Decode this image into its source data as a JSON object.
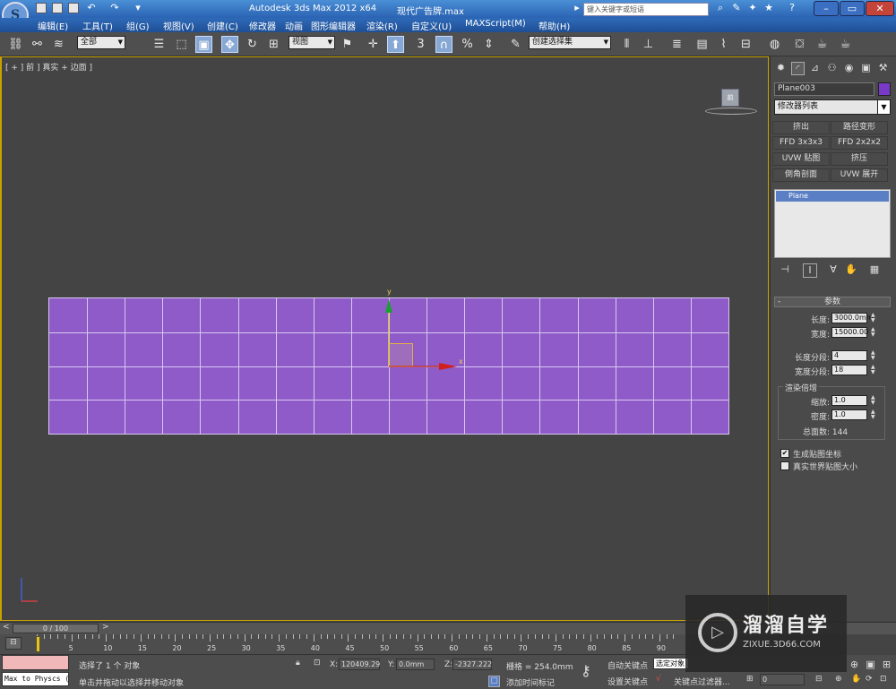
{
  "app": {
    "title": "Autodesk 3ds Max  2012 x64",
    "file": "现代广告牌.max",
    "search_placeholder": "键入关键字或短语"
  },
  "menu": [
    "编辑(E)",
    "工具(T)",
    "组(G)",
    "视图(V)",
    "创建(C)",
    "修改器",
    "动画",
    "图形编辑器",
    "渲染(R)",
    "自定义(U)",
    "MAXScript(M)",
    "帮助(H)"
  ],
  "toolbar": {
    "selection_filter": "全部",
    "ref_coord": "视图",
    "named_selection": "创建选择集",
    "snap_angle_label": "3",
    "percent_snap_label": "%"
  },
  "viewport": {
    "label": "[ + ] 前 ] 真实 + 边面 ]",
    "cube_face": "前",
    "gizmo_y": "y",
    "gizmo_x": "x",
    "plane_color": "#8e5bc9",
    "grid_columns": 18,
    "grid_rows": 4
  },
  "command_panel": {
    "object_name": "Plane003",
    "object_color": "#7a3ac8",
    "modifier_list": "修改器列表",
    "modifier_buttons": [
      "挤出",
      "路径变形",
      "FFD 3x3x3",
      "FFD 2x2x2",
      "UVW 贴图",
      "挤压",
      "倒角剖面",
      "UVW 展开"
    ],
    "stack_item": "Plane",
    "rollout_title": "参数",
    "params": {
      "length_label": "长度:",
      "length_value": "3000.0mm",
      "width_label": "宽度:",
      "width_value": "15000.00",
      "length_segs_label": "长度分段:",
      "length_segs_value": "4",
      "width_segs_label": "宽度分段:",
      "width_segs_value": "18"
    },
    "render_multipliers": {
      "group_title": "渲染倍增",
      "scale_label": "缩放:",
      "scale_value": "1.0",
      "density_label": "密度:",
      "density_value": "1.0",
      "total_faces": "总面数: 144"
    },
    "gen_mapping": "生成贴图坐标",
    "real_world": "真实世界贴图大小"
  },
  "timeline": {
    "slider": "0 / 100",
    "ticks": [
      0,
      5,
      10,
      15,
      20,
      25,
      30,
      35,
      40,
      45,
      50,
      55,
      60,
      65,
      70,
      75,
      80,
      85,
      90
    ]
  },
  "status": {
    "maxscript_label": "Max to Physcs (",
    "selection": "选择了 1 个 对象",
    "prompt": "单击并拖动以选择并移动对象",
    "x_label": "X:",
    "x_value": "120409.29",
    "y_label": "Y:",
    "y_value": "0.0mm",
    "z_label": "Z:",
    "z_value": "-2327.222",
    "grid": "栅格 = 254.0mm",
    "add_time_tag": "添加时间标记",
    "auto_key": "自动关键点",
    "set_key": "设置关键点",
    "selected_label": "选定对象",
    "key_filters": "关键点过滤器...",
    "frame": "0"
  },
  "watermark": {
    "title": "溜溜自学",
    "url": "ZIXUE.3D66.COM"
  }
}
